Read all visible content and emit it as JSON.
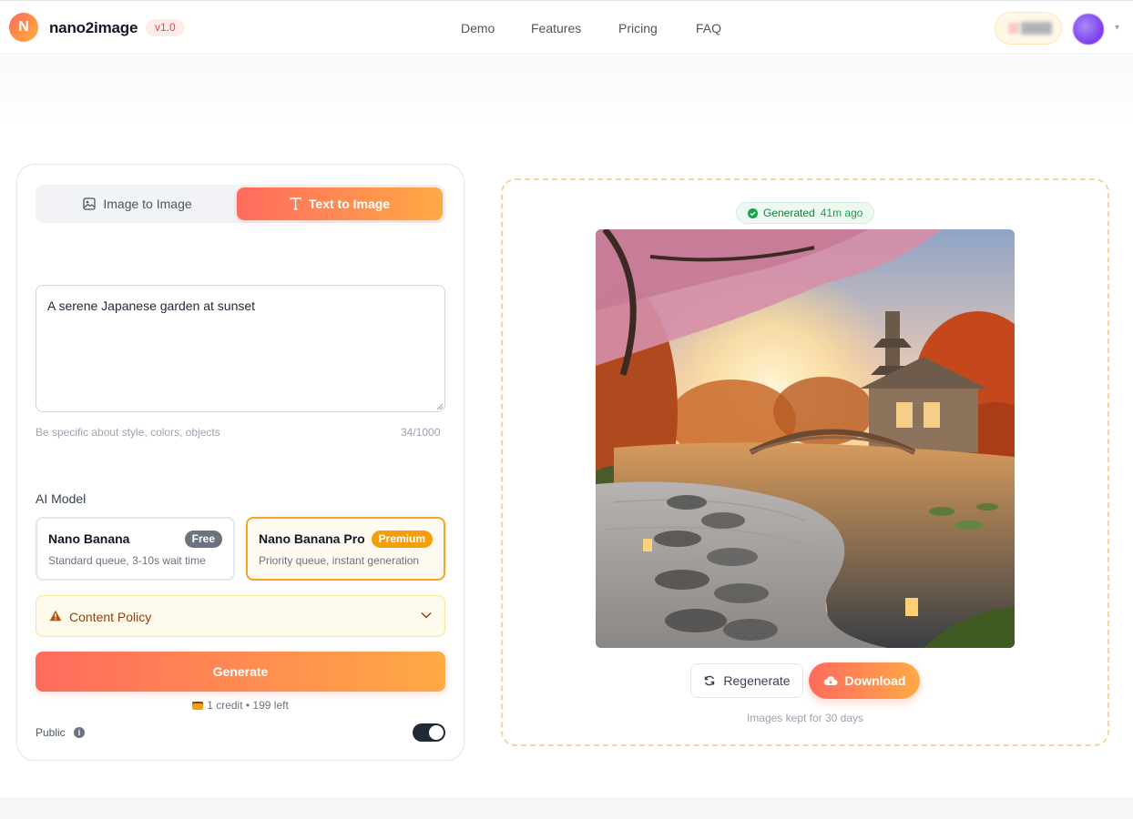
{
  "header": {
    "logo_letter": "N",
    "brand": "nano2image",
    "version": "v1.0",
    "nav": [
      {
        "label": "Demo"
      },
      {
        "label": "Features"
      },
      {
        "label": "Pricing"
      },
      {
        "label": "FAQ"
      }
    ]
  },
  "composer": {
    "tabs": [
      {
        "label": "Image to Image",
        "icon": "image-icon",
        "active": false
      },
      {
        "label": "Text to Image",
        "icon": "text-icon",
        "active": true
      }
    ],
    "prompt": {
      "value": "A serene Japanese garden at sunset",
      "hint": "Be specific about style, colors, objects",
      "counter": "34/1000"
    },
    "model_label": "AI Model",
    "models": [
      {
        "name": "Nano Banana",
        "badge": "Free",
        "desc": "Standard queue, 3-10s wait time",
        "selected": false
      },
      {
        "name": "Nano Banana Pro",
        "badge": "Premium",
        "desc": "Priority queue, instant generation",
        "selected": true
      }
    ],
    "policy_label": "Content Policy",
    "generate_label": "Generate",
    "credit_line": "1 credit • 199 left",
    "public_label": "Public",
    "public_enabled": true
  },
  "result": {
    "status": "Generated",
    "time": "41m ago",
    "regenerate_label": "Regenerate",
    "download_label": "Download",
    "kept_note": "Images kept for 30 days"
  },
  "colors": {
    "accent_start": "#ff6b5e",
    "accent_end": "#ffaa45",
    "success": "#16a34a",
    "premium": "#f59e0b"
  }
}
